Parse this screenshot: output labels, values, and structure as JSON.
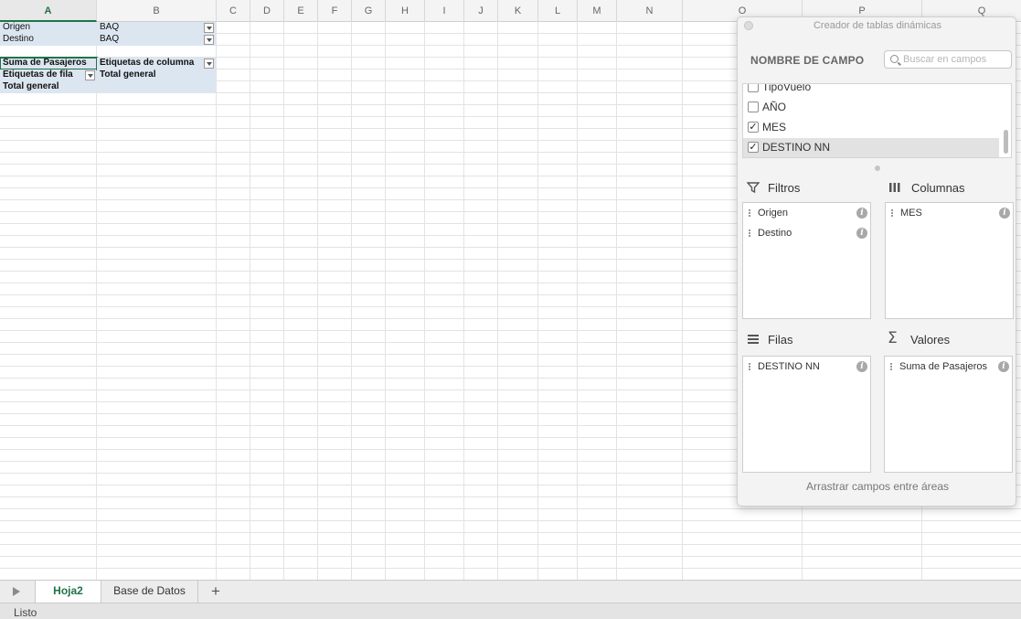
{
  "sheet": {
    "columns": [
      "A",
      "B",
      "C",
      "D",
      "E",
      "F",
      "G",
      "H",
      "I",
      "J",
      "K",
      "L",
      "M",
      "N",
      "O",
      "P",
      "Q"
    ],
    "selected_column": "A",
    "cells": {
      "r1a": "Origen",
      "r1b": "BAQ",
      "r2a": "Destino",
      "r2b": "BAQ",
      "r4a": "Suma de Pasajeros",
      "r4b": "Etiquetas de columna",
      "r5a": "Etiquetas de fila",
      "r5b": "Total general",
      "r6a": "Total general"
    }
  },
  "tabs": {
    "items": [
      {
        "label": "Hoja2",
        "active": true
      },
      {
        "label": "Base de Datos",
        "active": false
      }
    ],
    "add_label": "+"
  },
  "status": {
    "text": "Listo"
  },
  "pivot": {
    "title": "Creador de tablas dinámicas",
    "field_name_header": "NOMBRE DE CAMPO",
    "search_placeholder": "Buscar en campos",
    "fields": [
      {
        "label": "TipoVuelo",
        "checked": false
      },
      {
        "label": "AÑO",
        "checked": false
      },
      {
        "label": "MES",
        "checked": true
      },
      {
        "label": "DESTINO NN",
        "checked": true
      }
    ],
    "areas": {
      "filters": {
        "title": "Filtros",
        "items": [
          "Origen",
          "Destino"
        ]
      },
      "columns": {
        "title": "Columnas",
        "items": [
          "MES"
        ]
      },
      "rows": {
        "title": "Filas",
        "items": [
          "DESTINO NN"
        ]
      },
      "values": {
        "title": "Valores",
        "items": [
          "Suma de Pasajeros"
        ]
      }
    },
    "footer": "Arrastrar campos entre áreas"
  },
  "colors": {
    "accent": "#217346",
    "pivot_blue": "#dce6f1"
  }
}
